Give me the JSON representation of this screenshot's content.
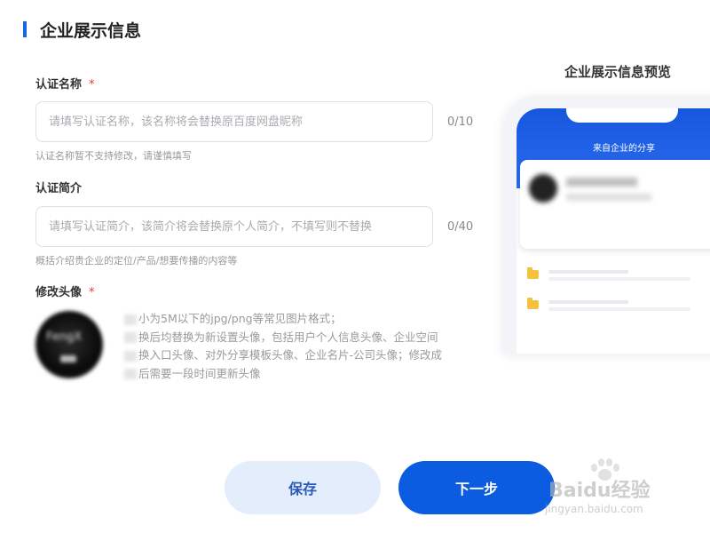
{
  "page": {
    "title": "企业展示信息"
  },
  "form": {
    "cert_name": {
      "label": "认证名称",
      "required_mark": "*",
      "placeholder": "请填写认证名称，该名称将会替换原百度网盘昵称",
      "value": "",
      "counter": "0/10",
      "hint": "认证名称暂不支持修改，请谨慎填写"
    },
    "cert_intro": {
      "label": "认证简介",
      "placeholder": "请填写认证简介，该简介将会替换原个人简介，不填写则不替换",
      "value": "",
      "counter": "0/40",
      "hint": "概括介绍贵企业的定位/产品/想要传播的内容等"
    },
    "avatar": {
      "label": "修改头像",
      "required_mark": "*",
      "image_text": "FengX",
      "desc_lines": [
        "小为5M以下的jpg/png等常见图片格式；",
        "换后均替换为新设置头像，包括用户个人信息头像、企业空间",
        "换入口头像、对外分享模板头像、企业名片-公司头像；修改成",
        "后需要一段时间更新头像"
      ]
    }
  },
  "preview": {
    "title": "企业展示信息预览",
    "header_title": "来自企业的分享",
    "folder_icon_color": "#f6c23e"
  },
  "buttons": {
    "save_label": "保存",
    "next_label": "下一步"
  },
  "watermark": {
    "logo": "Baidu经验",
    "url": "jingyan.baidu.com"
  },
  "colors": {
    "accent": "#0b5ce0",
    "required": "#e23a3a"
  }
}
